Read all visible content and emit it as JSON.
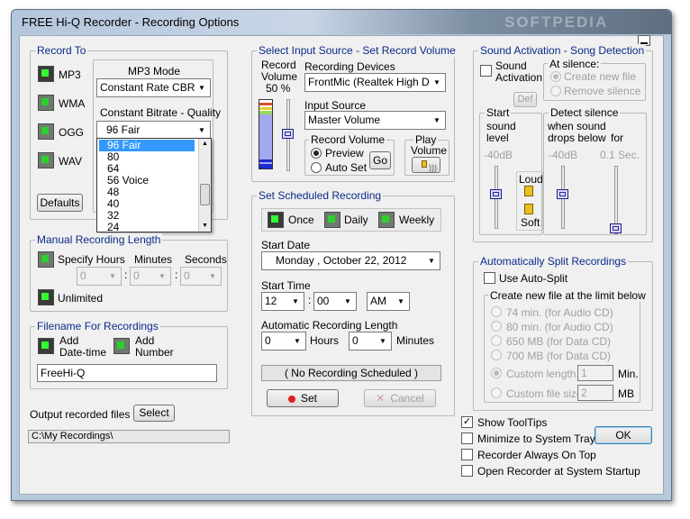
{
  "window": {
    "title": "FREE Hi-Q Recorder - Recording Options",
    "watermark": "SOFTPEDIA"
  },
  "record_to": {
    "title": "Record To",
    "formats": [
      {
        "label": "MP3"
      },
      {
        "label": "WMA"
      },
      {
        "label": "OGG"
      },
      {
        "label": "WAV"
      }
    ],
    "mp3_mode_label": "MP3 Mode",
    "mp3_mode_value": "Constant Rate CBR",
    "bitrate_label": "Constant Bitrate - Quality",
    "bitrate_value": "96   Fair",
    "bitrate_options": [
      "96   Fair",
      "80",
      "64",
      "56   Voice",
      "48",
      "40",
      "32",
      "24"
    ],
    "selected_option": 0,
    "defaults_label": "Defaults"
  },
  "manual_length": {
    "title": "Manual Recording Length",
    "specify_hours": "Specify Hours",
    "minutes": "Minutes",
    "seconds": "Seconds",
    "hours_value": "0",
    "minutes_value": "0",
    "seconds_value": "0",
    "unlimited": "Unlimited"
  },
  "filename": {
    "title": "Filename For Recordings",
    "add_datetime": "Add\nDate-time",
    "add_datetime_l1": "Add",
    "add_datetime_l2": "Date-time",
    "add_number_l1": "Add",
    "add_number_l2": "Number",
    "value": "FreeHi-Q"
  },
  "output": {
    "label": "Output recorded files to",
    "select_label": "Select",
    "path": "C:\\My Recordings\\"
  },
  "input_source": {
    "title": "Select Input Source - Set Record Volume",
    "record_volume_l1": "Record",
    "record_volume_l2": "Volume",
    "record_volume_pct": "50 %",
    "devices_label": "Recording Devices",
    "device_value": "FrontMic (Realtek High Defir",
    "input_source_label": "Input Source",
    "input_source_value": "Master Volume",
    "record_volume_box": "Record Volume",
    "preview": "Preview",
    "auto_set": "Auto Set",
    "go": "Go",
    "play_volume_l1": "Play",
    "play_volume_l2": "Volume"
  },
  "scheduled": {
    "title": "Set Scheduled Recording",
    "once": "Once",
    "daily": "Daily",
    "weekly": "Weekly",
    "start_date_label": "Start Date",
    "date_value": "Monday   ,  October  22, 2012",
    "start_time_label": "Start Time",
    "hour": "12",
    "minute": "00",
    "ampm": "AM",
    "colon": ":",
    "auto_length_label": "Automatic Recording Length",
    "hours_value": "0",
    "hours_label": "Hours",
    "minutes_value": "0",
    "minutes_label": "Minutes",
    "status": "( No Recording Scheduled )",
    "set": "Set",
    "cancel": "Cancel"
  },
  "sound_activation": {
    "title": "Sound Activation - Song Detection",
    "sound_activation_l1": "Sound",
    "sound_activation_l2": "Activation",
    "at_silence": "At silence:",
    "create_new_file": "Create new file",
    "remove_silence": "Remove silence",
    "def": "Def",
    "start_sound_level_l1": "Start",
    "start_sound_level_l2": "sound",
    "start_sound_level_l3": "level",
    "start_db": "-40dB",
    "detect_silence": "Detect silence",
    "when_drops_l1": "when sound",
    "when_drops_l2": "drops below",
    "for": "for",
    "detect_db": "-40dB",
    "secs": "0.1  Sec.",
    "loud": "Loud",
    "soft": "Soft"
  },
  "split": {
    "title": "Automatically Split Recordings",
    "use_auto_split": "Use Auto-Split",
    "limit_title": "Create new file at the limit below",
    "options": [
      "74 min. (for Audio CD)",
      "80 min. (for Audio CD)",
      "650 MB (for Data CD)",
      "700 MB (for Data CD)"
    ],
    "custom_length": "Custom length",
    "custom_length_value": "1",
    "custom_length_unit": "Min.",
    "custom_size": "Custom file size",
    "custom_size_value": "2",
    "custom_size_unit": "MB"
  },
  "options": {
    "show_tooltips": "Show ToolTips",
    "minimize_tray": "Minimize to System Tray",
    "always_on_top": "Recorder Always On Top",
    "open_startup": "Open Recorder at System Startup",
    "ok": "OK"
  },
  "colors": {
    "accent": "#0a2a8a",
    "selection": "#3399ff",
    "led_green": "#32ff32"
  }
}
